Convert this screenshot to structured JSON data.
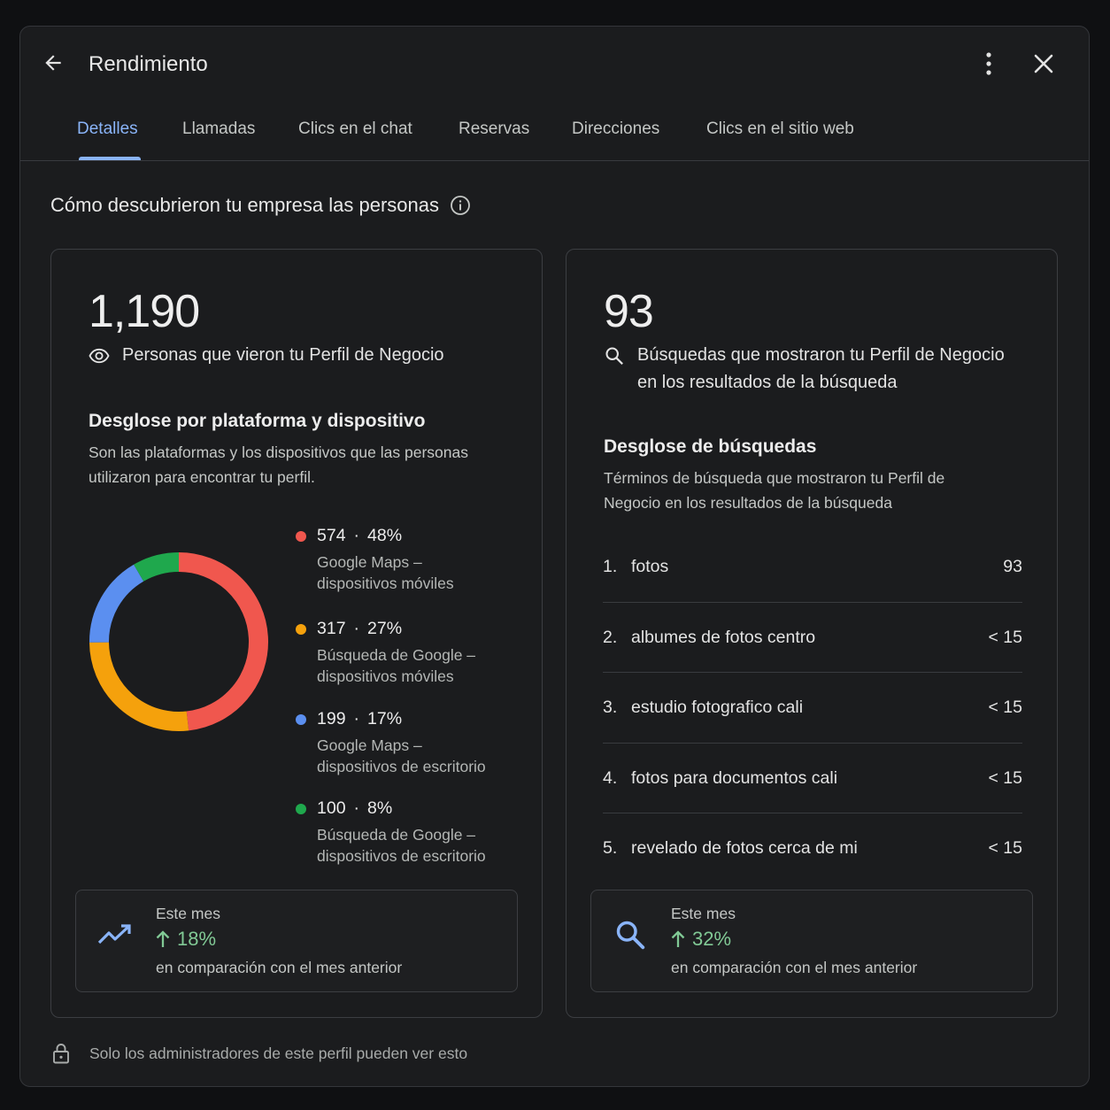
{
  "header": {
    "title": "Rendimiento",
    "back_icon": "arrow-back-icon",
    "more_icon": "more-vert-icon",
    "close_icon": "close-icon"
  },
  "tabs": [
    {
      "label": "Detalles",
      "active": true
    },
    {
      "label": "Llamadas",
      "active": false
    },
    {
      "label": "Clics en el chat",
      "active": false
    },
    {
      "label": "Reservas",
      "active": false
    },
    {
      "label": "Direcciones",
      "active": false
    },
    {
      "label": "Clics en el sitio web",
      "active": false
    }
  ],
  "section": {
    "title": "Cómo descubrieron tu empresa las personas",
    "info_icon": "info-icon"
  },
  "profile_views": {
    "value": "1,190",
    "label": "Personas que vieron tu Perfil de Negocio",
    "icon": "eye-icon",
    "breakdown_title": "Desglose por plataforma y dispositivo",
    "breakdown_desc": "Son las plataformas y los dispositivos que las personas utilizaron para encontrar tu perfil.",
    "legend": [
      {
        "value": "574",
        "percent": "48%",
        "label_line1": "Google Maps –",
        "label_line2": "dispositivos móviles",
        "color": "#f0574e"
      },
      {
        "value": "317",
        "percent": "27%",
        "label_line1": "Búsqueda de Google –",
        "label_line2": "dispositivos móviles",
        "color": "#f5a10c"
      },
      {
        "value": "199",
        "percent": "17%",
        "label_line1": "Google Maps –",
        "label_line2": "dispositivos de escritorio",
        "color": "#5b8ff0"
      },
      {
        "value": "100",
        "percent": "8%",
        "label_line1": "Búsqueda de Google –",
        "label_line2": "dispositivos de escritorio",
        "color": "#1fa84d"
      }
    ],
    "compare": {
      "period": "Este mes",
      "change": "18%",
      "note": "en comparación con el mes anterior",
      "icon": "trending-up-icon",
      "arrow_icon": "arrow-up-icon"
    }
  },
  "chart_data": {
    "type": "pie",
    "categories": [
      "Google Maps – dispositivos móviles",
      "Búsqueda de Google – dispositivos móviles",
      "Google Maps – dispositivos de escritorio",
      "Búsqueda de Google – dispositivos de escritorio"
    ],
    "values": [
      574,
      317,
      199,
      100
    ],
    "percent": [
      48,
      27,
      17,
      8
    ],
    "colors": [
      "#f0574e",
      "#f5a10c",
      "#5b8ff0",
      "#1fa84d"
    ],
    "style": "donut",
    "legend_position": "right"
  },
  "searches": {
    "value": "93",
    "label_line1": "Búsquedas que mostraron tu Perfil de Negocio",
    "label_line2": "en los resultados de la búsqueda",
    "icon": "search-icon",
    "breakdown_title": "Desglose de búsquedas",
    "breakdown_desc": "Términos de búsqueda que mostraron tu Perfil de Negocio en los resultados de la búsqueda",
    "queries": [
      {
        "rank": "1.",
        "term": "fotos",
        "count": "93"
      },
      {
        "rank": "2.",
        "term": "albumes de fotos centro",
        "count": "< 15"
      },
      {
        "rank": "3.",
        "term": "estudio fotografico cali",
        "count": "< 15"
      },
      {
        "rank": "4.",
        "term": "fotos para documentos cali",
        "count": "< 15"
      },
      {
        "rank": "5.",
        "term": "revelado de fotos cerca de mi",
        "count": "< 15"
      }
    ],
    "compare": {
      "period": "Este mes",
      "change": "32%",
      "note": "en comparación con el mes anterior",
      "icon": "search-icon",
      "arrow_icon": "arrow-up-icon"
    }
  },
  "footer": {
    "text": "Solo los administradores de este perfil pueden ver esto",
    "icon": "lock-icon"
  }
}
